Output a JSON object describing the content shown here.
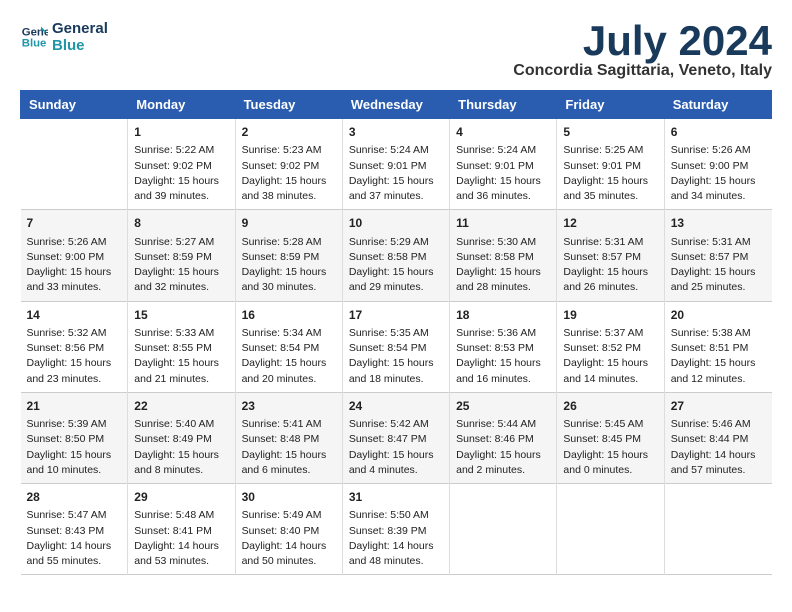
{
  "logo": {
    "line1": "General",
    "line2": "Blue"
  },
  "title": "July 2024",
  "location": "Concordia Sagittaria, Veneto, Italy",
  "headers": [
    "Sunday",
    "Monday",
    "Tuesday",
    "Wednesday",
    "Thursday",
    "Friday",
    "Saturday"
  ],
  "weeks": [
    [
      {
        "day": "",
        "content": ""
      },
      {
        "day": "1",
        "content": "Sunrise: 5:22 AM\nSunset: 9:02 PM\nDaylight: 15 hours and 39 minutes."
      },
      {
        "day": "2",
        "content": "Sunrise: 5:23 AM\nSunset: 9:02 PM\nDaylight: 15 hours and 38 minutes."
      },
      {
        "day": "3",
        "content": "Sunrise: 5:24 AM\nSunset: 9:01 PM\nDaylight: 15 hours and 37 minutes."
      },
      {
        "day": "4",
        "content": "Sunrise: 5:24 AM\nSunset: 9:01 PM\nDaylight: 15 hours and 36 minutes."
      },
      {
        "day": "5",
        "content": "Sunrise: 5:25 AM\nSunset: 9:01 PM\nDaylight: 15 hours and 35 minutes."
      },
      {
        "day": "6",
        "content": "Sunrise: 5:26 AM\nSunset: 9:00 PM\nDaylight: 15 hours and 34 minutes."
      }
    ],
    [
      {
        "day": "7",
        "content": "Sunrise: 5:26 AM\nSunset: 9:00 PM\nDaylight: 15 hours and 33 minutes."
      },
      {
        "day": "8",
        "content": "Sunrise: 5:27 AM\nSunset: 8:59 PM\nDaylight: 15 hours and 32 minutes."
      },
      {
        "day": "9",
        "content": "Sunrise: 5:28 AM\nSunset: 8:59 PM\nDaylight: 15 hours and 30 minutes."
      },
      {
        "day": "10",
        "content": "Sunrise: 5:29 AM\nSunset: 8:58 PM\nDaylight: 15 hours and 29 minutes."
      },
      {
        "day": "11",
        "content": "Sunrise: 5:30 AM\nSunset: 8:58 PM\nDaylight: 15 hours and 28 minutes."
      },
      {
        "day": "12",
        "content": "Sunrise: 5:31 AM\nSunset: 8:57 PM\nDaylight: 15 hours and 26 minutes."
      },
      {
        "day": "13",
        "content": "Sunrise: 5:31 AM\nSunset: 8:57 PM\nDaylight: 15 hours and 25 minutes."
      }
    ],
    [
      {
        "day": "14",
        "content": "Sunrise: 5:32 AM\nSunset: 8:56 PM\nDaylight: 15 hours and 23 minutes."
      },
      {
        "day": "15",
        "content": "Sunrise: 5:33 AM\nSunset: 8:55 PM\nDaylight: 15 hours and 21 minutes."
      },
      {
        "day": "16",
        "content": "Sunrise: 5:34 AM\nSunset: 8:54 PM\nDaylight: 15 hours and 20 minutes."
      },
      {
        "day": "17",
        "content": "Sunrise: 5:35 AM\nSunset: 8:54 PM\nDaylight: 15 hours and 18 minutes."
      },
      {
        "day": "18",
        "content": "Sunrise: 5:36 AM\nSunset: 8:53 PM\nDaylight: 15 hours and 16 minutes."
      },
      {
        "day": "19",
        "content": "Sunrise: 5:37 AM\nSunset: 8:52 PM\nDaylight: 15 hours and 14 minutes."
      },
      {
        "day": "20",
        "content": "Sunrise: 5:38 AM\nSunset: 8:51 PM\nDaylight: 15 hours and 12 minutes."
      }
    ],
    [
      {
        "day": "21",
        "content": "Sunrise: 5:39 AM\nSunset: 8:50 PM\nDaylight: 15 hours and 10 minutes."
      },
      {
        "day": "22",
        "content": "Sunrise: 5:40 AM\nSunset: 8:49 PM\nDaylight: 15 hours and 8 minutes."
      },
      {
        "day": "23",
        "content": "Sunrise: 5:41 AM\nSunset: 8:48 PM\nDaylight: 15 hours and 6 minutes."
      },
      {
        "day": "24",
        "content": "Sunrise: 5:42 AM\nSunset: 8:47 PM\nDaylight: 15 hours and 4 minutes."
      },
      {
        "day": "25",
        "content": "Sunrise: 5:44 AM\nSunset: 8:46 PM\nDaylight: 15 hours and 2 minutes."
      },
      {
        "day": "26",
        "content": "Sunrise: 5:45 AM\nSunset: 8:45 PM\nDaylight: 15 hours and 0 minutes."
      },
      {
        "day": "27",
        "content": "Sunrise: 5:46 AM\nSunset: 8:44 PM\nDaylight: 14 hours and 57 minutes."
      }
    ],
    [
      {
        "day": "28",
        "content": "Sunrise: 5:47 AM\nSunset: 8:43 PM\nDaylight: 14 hours and 55 minutes."
      },
      {
        "day": "29",
        "content": "Sunrise: 5:48 AM\nSunset: 8:41 PM\nDaylight: 14 hours and 53 minutes."
      },
      {
        "day": "30",
        "content": "Sunrise: 5:49 AM\nSunset: 8:40 PM\nDaylight: 14 hours and 50 minutes."
      },
      {
        "day": "31",
        "content": "Sunrise: 5:50 AM\nSunset: 8:39 PM\nDaylight: 14 hours and 48 minutes."
      },
      {
        "day": "",
        "content": ""
      },
      {
        "day": "",
        "content": ""
      },
      {
        "day": "",
        "content": ""
      }
    ]
  ]
}
